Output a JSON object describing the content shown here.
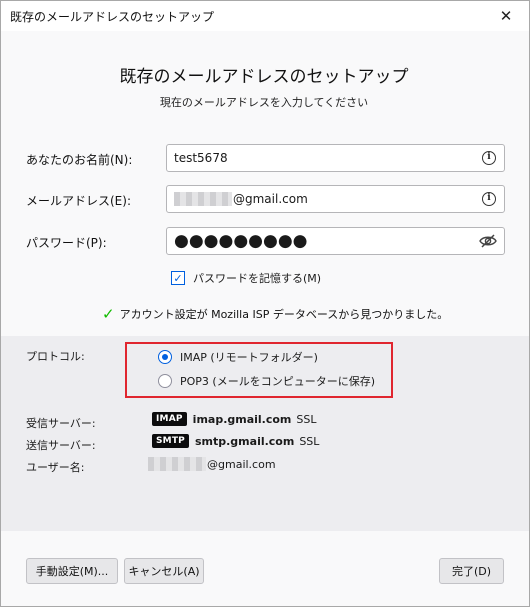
{
  "window": {
    "title": "既存のメールアドレスのセットアップ",
    "close_glyph": "✕"
  },
  "header": {
    "heading": "既存のメールアドレスのセットアップ",
    "subheading": "現在のメールアドレスを入力してください"
  },
  "form": {
    "name_label": "あなたのお名前(N):",
    "name_value": "test5678",
    "email_label": "メールアドレス(E):",
    "email_value_suffix": "@gmail.com",
    "password_label": "パスワード(P):",
    "password_mask": "●●●●●●●●●",
    "remember_password_label": "パスワードを記憶する(M)",
    "remember_password_checked": true
  },
  "status": {
    "message": "アカウント設定が Mozilla ISP データベースから見つかりました。",
    "color": "#12bc00"
  },
  "protocol": {
    "label": "プロトコル:",
    "options": [
      {
        "label": "IMAP (リモートフォルダー)",
        "checked": true
      },
      {
        "label": "POP3 (メールをコンピューターに保存)",
        "checked": false
      }
    ],
    "highlight_color": "#e0262f"
  },
  "servers": {
    "incoming_label": "受信サーバー:",
    "incoming_badge": "IMAP",
    "incoming_host": "imap.gmail.com",
    "incoming_security": "SSL",
    "outgoing_label": "送信サーバー:",
    "outgoing_badge": "SMTP",
    "outgoing_host": "smtp.gmail.com",
    "outgoing_security": "SSL",
    "username_label": "ユーザー名:",
    "username_suffix": "@gmail.com"
  },
  "buttons": {
    "manual_config": "手動設定(M)...",
    "cancel": "キャンセル(A)",
    "done": "完了(D)"
  }
}
